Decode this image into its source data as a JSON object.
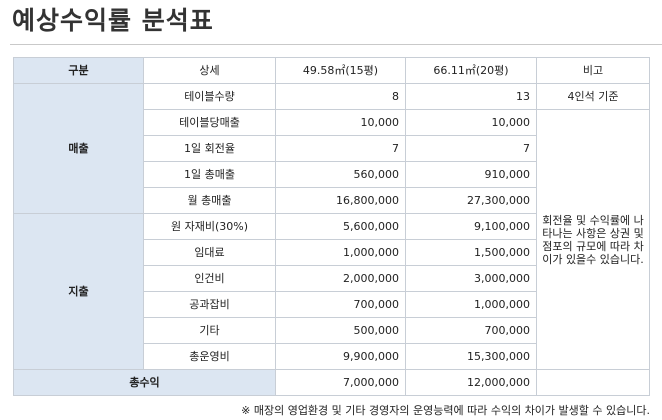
{
  "title": "예상수익률 분석표",
  "header": {
    "category": "구분",
    "detail": "상세",
    "col1": "49.58㎡(15평)",
    "col2": "66.11㎡(20평)",
    "remark": "비고"
  },
  "groups": {
    "revenue": "매출",
    "expense": "지출",
    "total": "총수익"
  },
  "rows": [
    {
      "label": "테이블수량",
      "v1": "8",
      "v2": "13"
    },
    {
      "label": "테이블당매출",
      "v1": "10,000",
      "v2": "10,000"
    },
    {
      "label": "1일 회전율",
      "v1": "7",
      "v2": "7"
    },
    {
      "label": "1일 총매출",
      "v1": "560,000",
      "v2": "910,000"
    },
    {
      "label": "월 총매출",
      "v1": "16,800,000",
      "v2": "27,300,000"
    },
    {
      "label": "원 자재비(30%)",
      "v1": "5,600,000",
      "v2": "9,100,000"
    },
    {
      "label": "임대료",
      "v1": "1,000,000",
      "v2": "1,500,000"
    },
    {
      "label": "인건비",
      "v1": "2,000,000",
      "v2": "3,000,000"
    },
    {
      "label": "공과잡비",
      "v1": "700,000",
      "v2": "1,000,000"
    },
    {
      "label": "기타",
      "v1": "500,000",
      "v2": "700,000"
    },
    {
      "label": "총운영비",
      "v1": "9,900,000",
      "v2": "15,300,000"
    }
  ],
  "total": {
    "v1": "7,000,000",
    "v2": "12,000,000"
  },
  "remarks": {
    "first": "4인석 기준",
    "note": "회전율 및 수익률에 나타나는 사항은 상권 및 점포의 규모에 따라 차이가 있을수 있습니다."
  },
  "footnote": "※ 매장의 영업환경 및 기타 경영자의 운영능력에 따라 수익의 차이가 발생할 수 있습니다.",
  "colors": {
    "header_bg": "#dce6f2",
    "border": "#c8ced6"
  }
}
